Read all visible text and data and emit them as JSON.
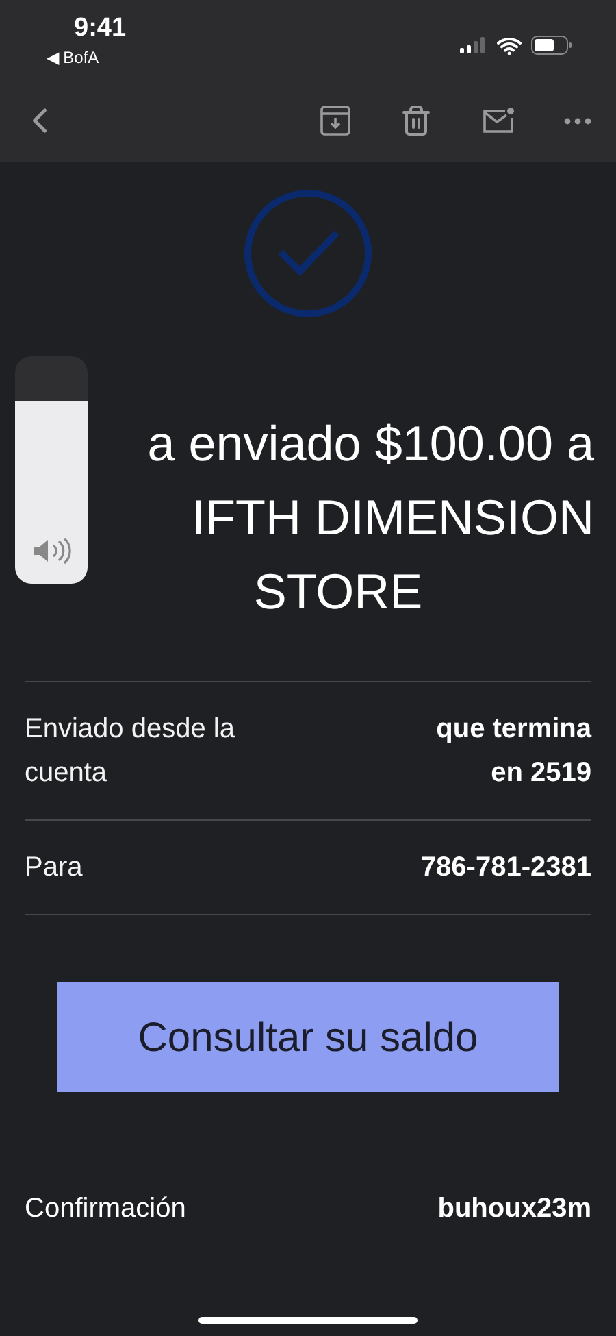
{
  "status_bar": {
    "time": "9:41",
    "back_app": "◀ BofA"
  },
  "volume_hud": {
    "level": 0.8
  },
  "heading_lines": [
    "a enviado $100.00 a",
    "IFTH DIMENSION",
    "STORE"
  ],
  "details": [
    {
      "label": "Enviado desde la cuenta",
      "value": "que termina en 2519"
    },
    {
      "label": "Para",
      "value": "786-781-2381"
    }
  ],
  "balance_button": "Consultar su saldo",
  "confirmation": {
    "label": "Confirmación",
    "value": "buhoux23m"
  }
}
